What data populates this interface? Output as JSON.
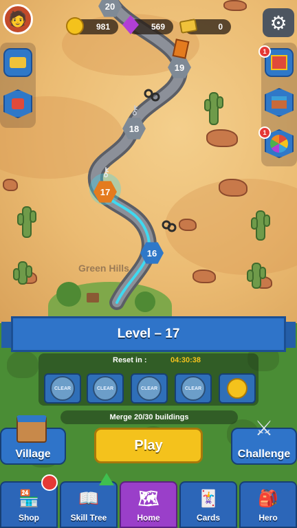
{
  "hud": {
    "coins": "981",
    "gems": "569",
    "tickets": "0"
  },
  "map": {
    "region_label": "Green Hills",
    "nodes": [
      "20",
      "19",
      "18",
      "17",
      "16"
    ],
    "current_level": "17"
  },
  "side_left": {
    "items": [
      "ticket-pass-icon",
      "clan-shield-icon"
    ]
  },
  "side_right": {
    "items": [
      {
        "icon": "gift-box-icon",
        "badge": "1"
      },
      {
        "icon": "market-stall-icon",
        "badge": ""
      },
      {
        "icon": "prize-wheel-icon",
        "badge": "1"
      }
    ]
  },
  "level_panel": {
    "title": "Level – 17",
    "reset_label": "Reset in :",
    "reset_timer": "04:30:38",
    "clear_label": "CLEAR",
    "task": "Merge 20/30 buildings"
  },
  "buttons": {
    "village": "Village",
    "play": "Play",
    "challenge": "Challenge"
  },
  "tabs": [
    {
      "label": "Shop",
      "icon": "shop-icon",
      "badge": true
    },
    {
      "label": "Skill Tree",
      "icon": "skill-book-icon"
    },
    {
      "label": "Home",
      "icon": "map-icon",
      "active": true
    },
    {
      "label": "Cards",
      "icon": "cards-icon"
    },
    {
      "label": "Hero",
      "icon": "backpack-icon"
    }
  ],
  "colors": {
    "ribbon": "#2f74c9",
    "play_button": "#f4c21c",
    "active_tab": "#9a3fc9",
    "path_glow": "#3fd9f0"
  }
}
